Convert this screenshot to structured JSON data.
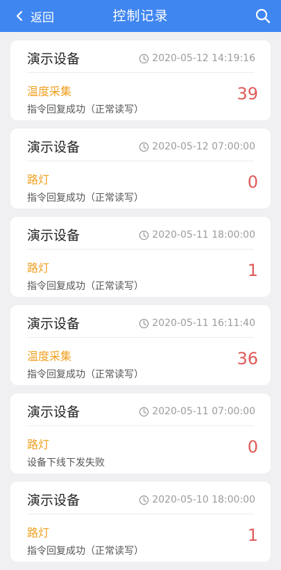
{
  "header": {
    "back_label": "返回",
    "title": "控制记录"
  },
  "records": [
    {
      "device": "演示设备",
      "time": "2020-05-12 14:19:16",
      "type": "温度采集",
      "status": "指令回复成功（正常读写）",
      "value": "39"
    },
    {
      "device": "演示设备",
      "time": "2020-05-12 07:00:00",
      "type": "路灯",
      "status": "指令回复成功（正常读写）",
      "value": "0"
    },
    {
      "device": "演示设备",
      "time": "2020-05-11 18:00:00",
      "type": "路灯",
      "status": "指令回复成功（正常读写）",
      "value": "1"
    },
    {
      "device": "演示设备",
      "time": "2020-05-11 16:11:40",
      "type": "温度采集",
      "status": "指令回复成功（正常读写）",
      "value": "36"
    },
    {
      "device": "演示设备",
      "time": "2020-05-11 07:00:00",
      "type": "路灯",
      "status": "设备下线下发失败",
      "value": "0"
    },
    {
      "device": "演示设备",
      "time": "2020-05-10 18:00:00",
      "type": "路灯",
      "status": "指令回复成功（正常读写）",
      "value": "1"
    }
  ],
  "colors": {
    "header_bg": "#3f86f0",
    "type_color": "#f0a020",
    "value_color": "#e05a5a"
  },
  "icons": {
    "back": "chevron-left-icon",
    "search": "search-icon",
    "time": "clock-icon"
  }
}
